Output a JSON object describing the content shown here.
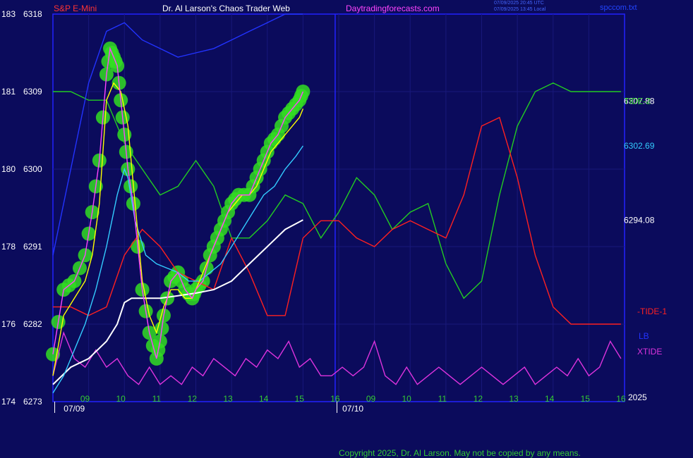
{
  "header": {
    "symbol": "S&P E-Mini",
    "title": "Dr. Al Larson's Chaos Trader Web",
    "site": "Daytradingforecasts.com",
    "timestamp_utc": "07/09/2025 20:45 UTC",
    "timestamp_local": "07/09/2025 13:45 Local",
    "file": "spccom.txt"
  },
  "footer": {
    "copyright": "Copyright 2025, Dr. Al Larson. May not be copied by any means."
  },
  "colors": {
    "background": "#0b0b5c",
    "frame": "#2222ff",
    "grid": "#18187a",
    "price": "#ff44ff",
    "smooth": "#ffff00",
    "ema": "#33ccff",
    "long_avg": "#ffffff",
    "tide1": "#ff2020",
    "tide2": "#22cc22",
    "xtide": "#dd33dd",
    "lb": "#2233ff",
    "blob": "#33dd22"
  },
  "chart_data": {
    "type": "line",
    "left_axis": [
      {
        "lo": "183",
        "hi": "6318"
      },
      {
        "lo": "181",
        "hi": "6309"
      },
      {
        "lo": "180",
        "hi": "6300"
      },
      {
        "lo": "178",
        "hi": "6291"
      },
      {
        "lo": "176",
        "hi": "6282"
      },
      {
        "lo": "174",
        "hi": "6273"
      }
    ],
    "ylim": [
      6273,
      6318
    ],
    "x_ticks": [
      "09",
      "10",
      "11",
      "12",
      "13",
      "14",
      "15",
      "16",
      "09",
      "10",
      "11",
      "12",
      "13",
      "14",
      "15",
      "16"
    ],
    "date_labels": [
      "07/09",
      "07/10"
    ],
    "year_label": "2025",
    "right_labels": [
      {
        "text": "6307.88",
        "value": 6307.88,
        "color": "#ffffff"
      },
      {
        "text": "TIDE-2",
        "value": 6307.88,
        "color": "#22cc22"
      },
      {
        "text": "6302.69",
        "value": 6302.69,
        "color": "#33ccff"
      },
      {
        "text": "6294.08",
        "value": 6294.08,
        "color": "#ffffff"
      }
    ],
    "right_tags": [
      {
        "text": "-TIDE-1",
        "color": "#ff2020"
      },
      {
        "text": "LB",
        "color": "#2233ff"
      },
      {
        "text": "XTIDE",
        "color": "#dd33dd"
      }
    ],
    "series": [
      {
        "name": "S&P E-Mini",
        "t": [
          0.0,
          0.3,
          0.6,
          0.9,
          1.1,
          1.3,
          1.5,
          1.6,
          1.7,
          1.8,
          1.9,
          2.0,
          2.1,
          2.25,
          2.5,
          2.7,
          2.9,
          3.0,
          3.1,
          3.3,
          3.5,
          3.7,
          3.9,
          4.0,
          4.2,
          4.4,
          4.6,
          4.8,
          5.0,
          5.2,
          5.5,
          5.7,
          5.9,
          6.1,
          6.3,
          6.5,
          6.7,
          6.9,
          7.0
        ],
        "values": [
          6278.5,
          6286,
          6287,
          6290,
          6295,
          6301,
          6311,
          6314,
          6313,
          6312,
          6308,
          6304,
          6300,
          6296,
          6286,
          6281,
          6278,
          6280,
          6283,
          6287,
          6288,
          6286,
          6285,
          6286,
          6287,
          6290,
          6292,
          6294,
          6296,
          6297,
          6297,
          6299,
          6301,
          6303,
          6304,
          6306,
          6307,
          6308,
          6309
        ]
      },
      {
        "name": "",
        "t": [
          0.0,
          0.3,
          0.6,
          0.9,
          1.1,
          1.3,
          1.5,
          1.7,
          1.9,
          2.1,
          2.3,
          2.5,
          2.7,
          2.9,
          3.1,
          3.3,
          3.5,
          3.7,
          3.9,
          4.1,
          4.3,
          4.5,
          4.7,
          4.9,
          5.1,
          5.3,
          5.5,
          5.7,
          5.9,
          6.1,
          6.3,
          6.5,
          6.7,
          6.9,
          7.0
        ],
        "values": [
          6276,
          6283,
          6285,
          6287,
          6290,
          6296,
          6308,
          6310,
          6309,
          6305,
          6296,
          6287,
          6283,
          6281,
          6284,
          6286,
          6286,
          6285,
          6285,
          6287,
          6289,
          6291,
          6293,
          6295,
          6296,
          6297,
          6297,
          6298,
          6300,
          6302,
          6303,
          6304,
          6305,
          6306,
          6307
        ]
      },
      {
        "name": "",
        "t": [
          0.0,
          0.3,
          0.6,
          0.9,
          1.2,
          1.5,
          1.8,
          2.0,
          2.1,
          2.3,
          2.6,
          2.9,
          3.2,
          3.5,
          3.8,
          4.1,
          4.4,
          4.7,
          5.0,
          5.3,
          5.6,
          5.9,
          6.2,
          6.5,
          6.8,
          7.0
        ],
        "values": [
          6274,
          6276,
          6279,
          6282,
          6286,
          6291,
          6297,
          6300,
          6299,
          6294,
          6290,
          6289,
          6288.5,
          6288,
          6287,
          6287,
          6288,
          6289,
          6291,
          6293,
          6295,
          6297,
          6298,
          6300,
          6301.5,
          6302.7
        ]
      },
      {
        "name": "",
        "t": [
          0.0,
          0.5,
          1.0,
          1.5,
          1.8,
          2.0,
          2.2,
          2.5,
          3.0,
          3.5,
          4.0,
          4.5,
          5.0,
          5.5,
          6.0,
          6.5,
          7.0
        ],
        "values": [
          6275,
          6277,
          6278,
          6280,
          6282,
          6284.5,
          6285,
          6285,
          6285,
          6285.3,
          6285.6,
          6286,
          6287,
          6289,
          6291,
          6293,
          6294.1
        ]
      },
      {
        "name": "TIDE-2",
        "t": [
          0.0,
          0.5,
          1.0,
          1.5,
          2.0,
          2.5,
          3.0,
          3.5,
          4.0,
          4.5,
          5.0,
          5.5,
          6.0,
          6.5,
          7.0,
          7.5,
          8.0,
          8.5,
          9.0,
          9.5,
          10.0,
          10.5,
          11.0,
          11.5,
          12.0,
          12.5,
          13.0,
          13.5,
          14.0,
          14.5,
          15.0,
          15.5,
          15.9
        ],
        "values": [
          6309,
          6309,
          6308,
          6308,
          6303,
          6300,
          6297,
          6298,
          6301,
          6298,
          6292,
          6292,
          6294,
          6297,
          6296,
          6292,
          6295,
          6299,
          6297,
          6293,
          6295,
          6296,
          6289,
          6285,
          6287,
          6297,
          6305,
          6309,
          6310,
          6309,
          6309,
          6309,
          6309
        ]
      },
      {
        "name": "TIDE-1",
        "t": [
          0.0,
          0.5,
          1.0,
          1.5,
          2.0,
          2.5,
          3.0,
          3.5,
          4.0,
          4.5,
          5.0,
          5.5,
          6.0,
          6.5,
          7.0,
          7.5,
          8.0,
          8.5,
          9.0,
          9.5,
          10.0,
          10.5,
          11.0,
          11.5,
          12.0,
          12.5,
          13.0,
          13.5,
          14.0,
          14.5,
          15.0,
          15.5,
          15.9
        ],
        "values": [
          6284,
          6284,
          6283,
          6284,
          6290,
          6293,
          6291,
          6288,
          6287,
          6286,
          6292,
          6288,
          6283,
          6283,
          6292,
          6294,
          6294,
          6292,
          6291,
          6293,
          6294,
          6293,
          6292,
          6297,
          6305,
          6306,
          6299,
          6290,
          6284,
          6282,
          6282,
          6282,
          6282
        ]
      },
      {
        "name": "XTIDE",
        "t": [
          0.0,
          0.3,
          0.6,
          0.9,
          1.2,
          1.5,
          1.8,
          2.1,
          2.4,
          2.7,
          3.0,
          3.3,
          3.6,
          3.9,
          4.2,
          4.5,
          4.8,
          5.1,
          5.4,
          5.7,
          6.0,
          6.3,
          6.6,
          6.9,
          7.2,
          7.5,
          7.8,
          8.1,
          8.4,
          8.7,
          9.0,
          9.3,
          9.6,
          9.9,
          10.2,
          10.5,
          10.8,
          11.1,
          11.4,
          11.7,
          12.0,
          12.3,
          12.6,
          12.9,
          13.2,
          13.5,
          13.8,
          14.1,
          14.4,
          14.7,
          15.0,
          15.3,
          15.6,
          15.9
        ],
        "values": [
          6276,
          6281,
          6278,
          6277,
          6279,
          6277,
          6278,
          6276,
          6275,
          6277,
          6275,
          6276,
          6275,
          6277,
          6276,
          6278,
          6277,
          6276,
          6278,
          6277,
          6279,
          6278,
          6280,
          6277,
          6278,
          6276,
          6276,
          6277,
          6276,
          6277,
          6280,
          6276,
          6275,
          6277,
          6275,
          6276,
          6277,
          6276,
          6275,
          6276,
          6277,
          6276,
          6275,
          6276,
          6277,
          6275,
          6276,
          6277,
          6276,
          6278,
          6276,
          6277,
          6280,
          6278
        ]
      },
      {
        "name": "LB",
        "t": [
          0.0,
          0.5,
          1.0,
          1.5,
          2.0,
          2.5,
          3.0,
          3.5,
          4.0,
          4.5,
          5.0,
          5.5,
          6.0,
          6.5,
          7.0
        ],
        "values": [
          6290,
          6300,
          6310,
          6316,
          6317,
          6315,
          6314,
          6313,
          6313.5,
          6314,
          6315,
          6316,
          6317,
          6318,
          6318
        ]
      }
    ]
  }
}
